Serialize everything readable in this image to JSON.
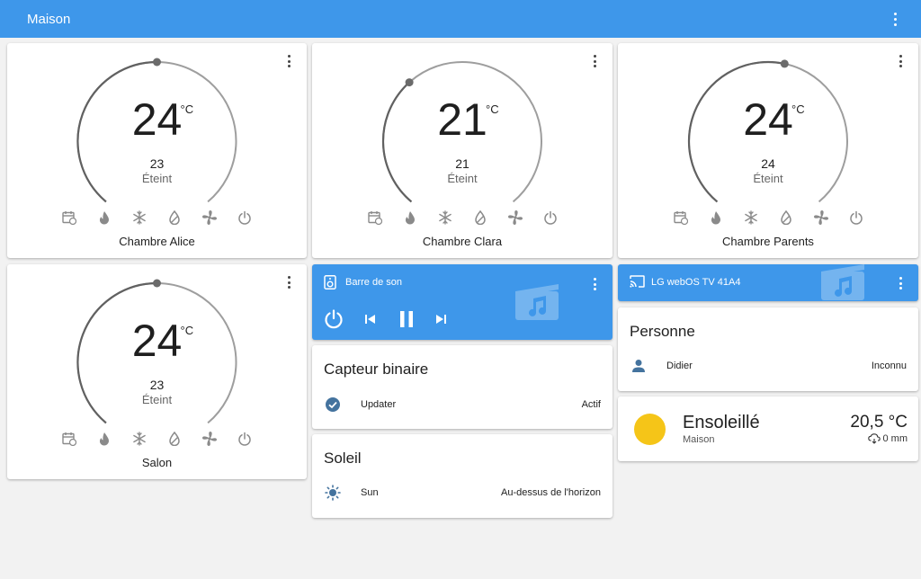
{
  "header": {
    "title": "Maison"
  },
  "thermostats": [
    {
      "temp": "24",
      "unit": "°C",
      "target": "23",
      "state": "Éteint",
      "name": "Chambre Alice"
    },
    {
      "temp": "21",
      "unit": "°C",
      "target": "21",
      "state": "Éteint",
      "name": "Chambre Clara"
    },
    {
      "temp": "24",
      "unit": "°C",
      "target": "24",
      "state": "Éteint",
      "name": "Chambre Parents"
    },
    {
      "temp": "24",
      "unit": "°C",
      "target": "23",
      "state": "Éteint",
      "name": "Salon"
    }
  ],
  "thermostat_modes": [
    "schedule-icon",
    "heat-icon",
    "cool-icon",
    "dry-icon",
    "fan-icon",
    "power-icon"
  ],
  "media_players": [
    {
      "title": "Barre de son",
      "icon": "speaker-icon"
    },
    {
      "title": "LG webOS TV 41A4",
      "icon": "cast-icon"
    }
  ],
  "binary_sensor": {
    "header": "Capteur binaire",
    "row": {
      "icon": "check-circle-icon",
      "name": "Updater",
      "value": "Actif"
    }
  },
  "sun": {
    "header": "Soleil",
    "row": {
      "icon": "sun-icon",
      "name": "Sun",
      "value": "Au-dessus de l'horizon"
    }
  },
  "person": {
    "header": "Personne",
    "row": {
      "icon": "person-icon",
      "name": "Didier",
      "value": "Inconnu"
    }
  },
  "weather": {
    "condition": "Ensoleillé",
    "location": "Maison",
    "temperature": "20,5 °C",
    "precipitation": "0 mm"
  },
  "colors": {
    "primary": "#3e97ea",
    "sun": "#f5c518",
    "icon": "#8a8a8a",
    "entity_icon": "#44739e"
  }
}
